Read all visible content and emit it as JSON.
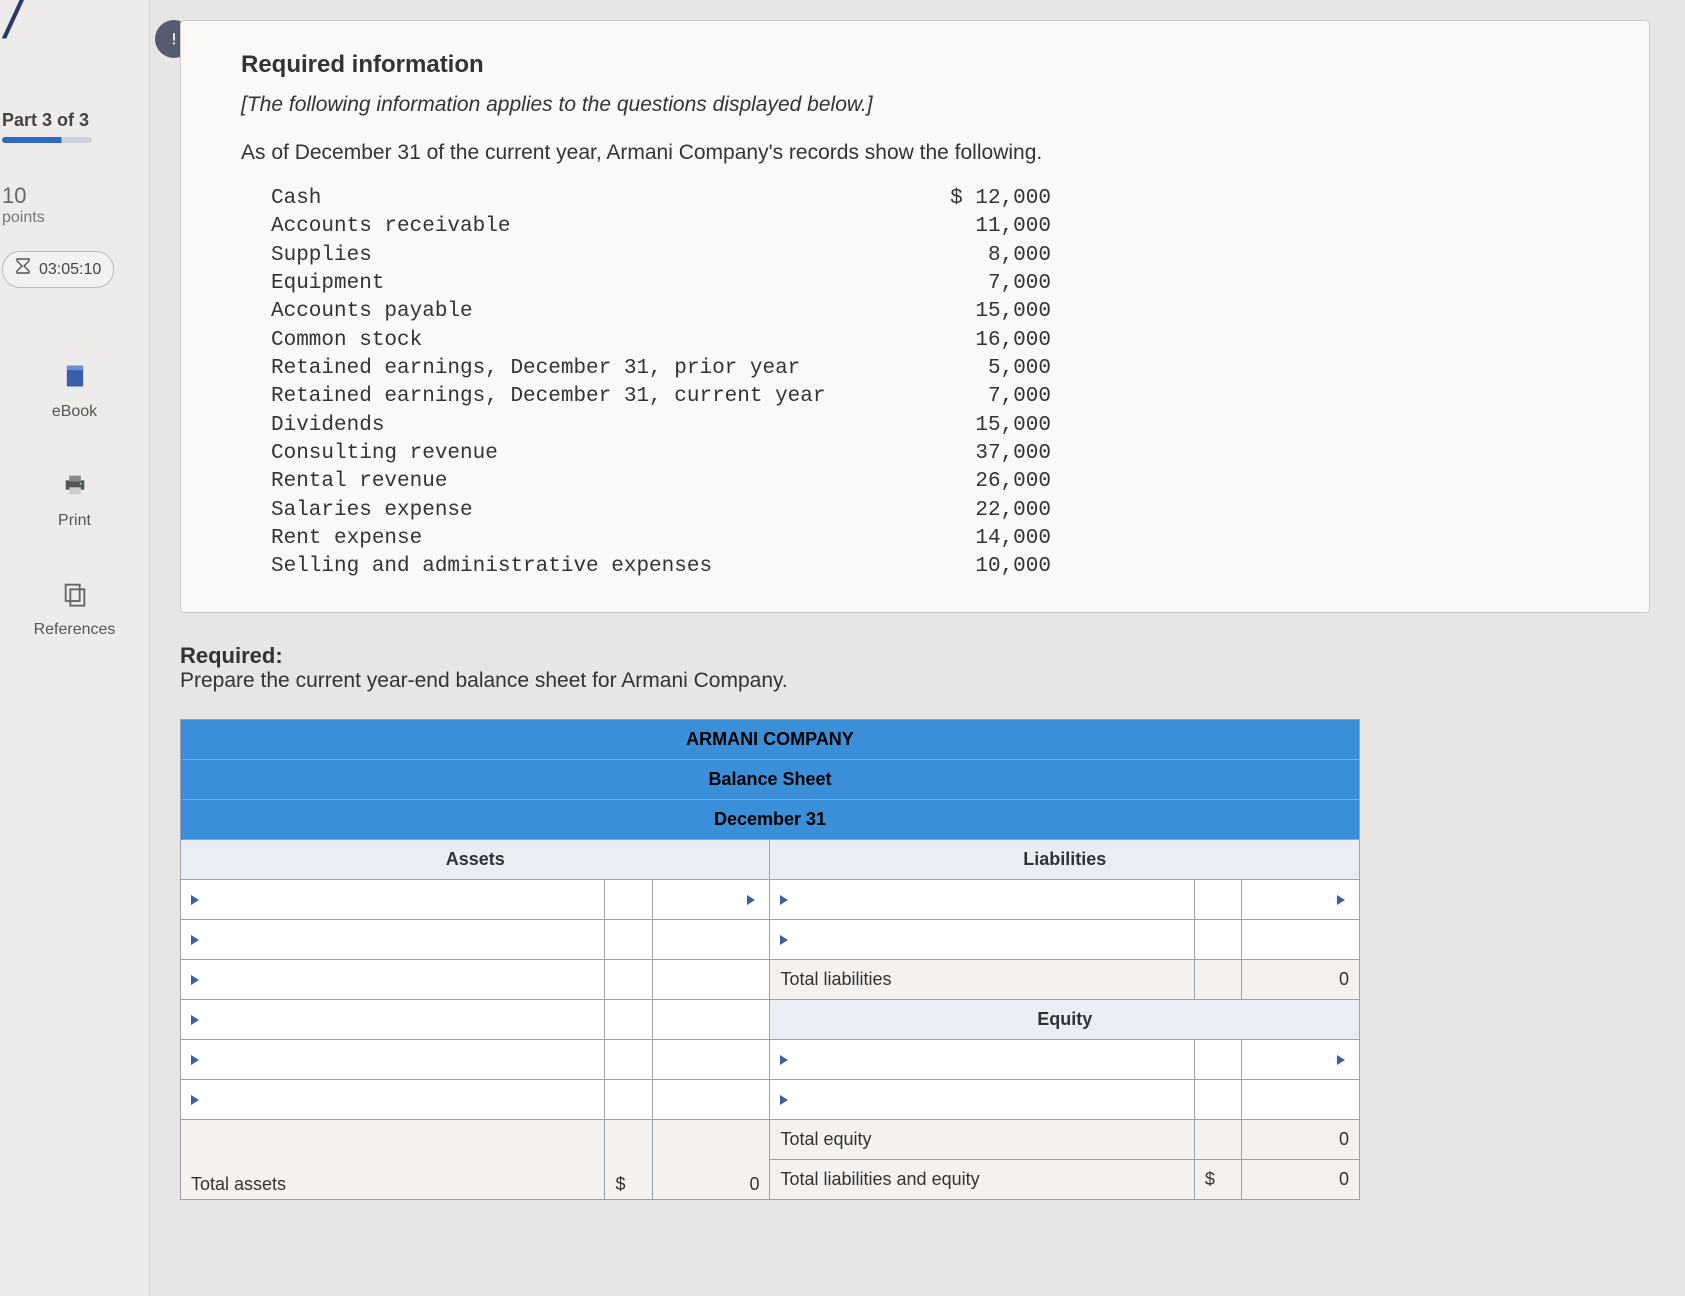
{
  "sidebar": {
    "part_label": "Part 3 of 3",
    "points_num": "10",
    "points_text": "points",
    "timer": "03:05:10",
    "ebook": "eBook",
    "print": "Print",
    "references": "References"
  },
  "info": {
    "required_title": "Required information",
    "subhead": "[The following information applies to the questions displayed below.]",
    "lead": "As of December 31 of the current year, Armani Company's records show the following.",
    "rows": [
      {
        "label": "Cash",
        "value": "$ 12,000"
      },
      {
        "label": "Accounts receivable",
        "value": "11,000"
      },
      {
        "label": "Supplies",
        "value": "8,000"
      },
      {
        "label": "Equipment",
        "value": "7,000"
      },
      {
        "label": "Accounts payable",
        "value": "15,000"
      },
      {
        "label": "Common stock",
        "value": "16,000"
      },
      {
        "label": "Retained earnings, December 31, prior year",
        "value": "5,000"
      },
      {
        "label": "Retained earnings, December 31, current year",
        "value": "7,000"
      },
      {
        "label": "Dividends",
        "value": "15,000"
      },
      {
        "label": "Consulting revenue",
        "value": "37,000"
      },
      {
        "label": "Rental revenue",
        "value": "26,000"
      },
      {
        "label": "Salaries expense",
        "value": "22,000"
      },
      {
        "label": "Rent expense",
        "value": "14,000"
      },
      {
        "label": "Selling and administrative expenses",
        "value": "10,000"
      }
    ]
  },
  "required": {
    "heading": "Required:",
    "text": "Prepare the current year-end balance sheet for Armani Company."
  },
  "sheet": {
    "title1": "ARMANI COMPANY",
    "title2": "Balance Sheet",
    "title3": "December 31",
    "assets_hdr": "Assets",
    "liab_hdr": "Liabilities",
    "equity_hdr": "Equity",
    "total_liab": "Total liabilities",
    "total_equity": "Total equity",
    "total_assets": "Total assets",
    "total_liab_eq": "Total liabilities and equity",
    "dollar": "$",
    "zero": "0"
  }
}
